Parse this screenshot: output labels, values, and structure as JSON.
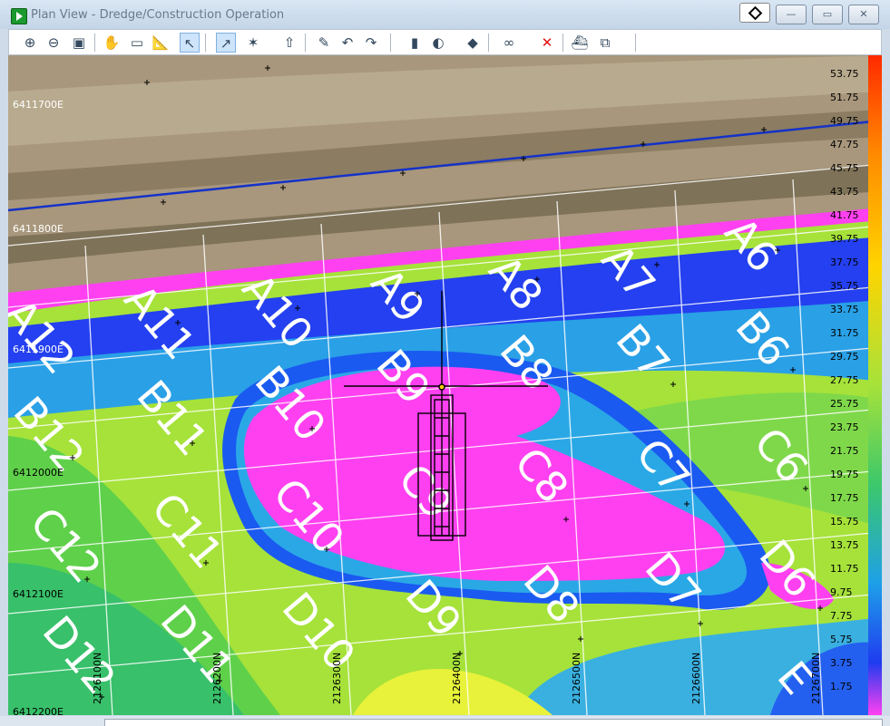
{
  "window": {
    "title": "Plan View - Dredge/Construction Operation",
    "min": "—",
    "max": "▭",
    "close": "✕"
  },
  "toolbar": {
    "icons": [
      "zoom-in-icon",
      "zoom-out-icon",
      "zoom-extent-icon",
      "pan-icon",
      "measure-icon",
      "ruler-icon",
      "select-arrow-icon",
      "draw-line-icon",
      "filter-icon",
      "north-arrow-icon",
      "edit-icon",
      "undo-icon",
      "redo-icon",
      "color-bar-icon",
      "color-palette-icon",
      "paint-icon",
      "track-icon",
      "delete-icon",
      "vessel-icon",
      "copy-window-icon"
    ]
  },
  "map": {
    "northing_labels": [
      "6411700E",
      "6411800E",
      "6411900E",
      "6412000E",
      "6412100E",
      "6412200E"
    ],
    "easting_labels": [
      "2126100N",
      "2126200N",
      "2126300N",
      "2126400N",
      "2126500N",
      "2126600N",
      "2126700N"
    ],
    "cells": [
      "A6",
      "A7",
      "A8",
      "A9",
      "A10",
      "A11",
      "A12",
      "B6",
      "B7",
      "B8",
      "B9",
      "B10",
      "B11",
      "B12",
      "C6",
      "C7",
      "C8",
      "C9",
      "C10",
      "C11",
      "C12",
      "D6",
      "D7",
      "D8",
      "D9",
      "D10",
      "D11",
      "D12",
      "E"
    ],
    "depth_scale": [
      "53.75",
      "51.75",
      "49.75",
      "47.75",
      "45.75",
      "43.75",
      "41.75",
      "39.75",
      "37.75",
      "35.75",
      "33.75",
      "31.75",
      "29.75",
      "27.75",
      "25.75",
      "23.75",
      "21.75",
      "19.75",
      "17.75",
      "15.75",
      "13.75",
      "11.75",
      "9.75",
      "7.75",
      "5.75",
      "3.75",
      "1.75"
    ],
    "colors": {
      "shallow": "#ff40f0",
      "deep": "#1f3cf0",
      "mid": "#4bd35a",
      "high": "#e8f23a",
      "bank_line": "#1532c8"
    }
  }
}
